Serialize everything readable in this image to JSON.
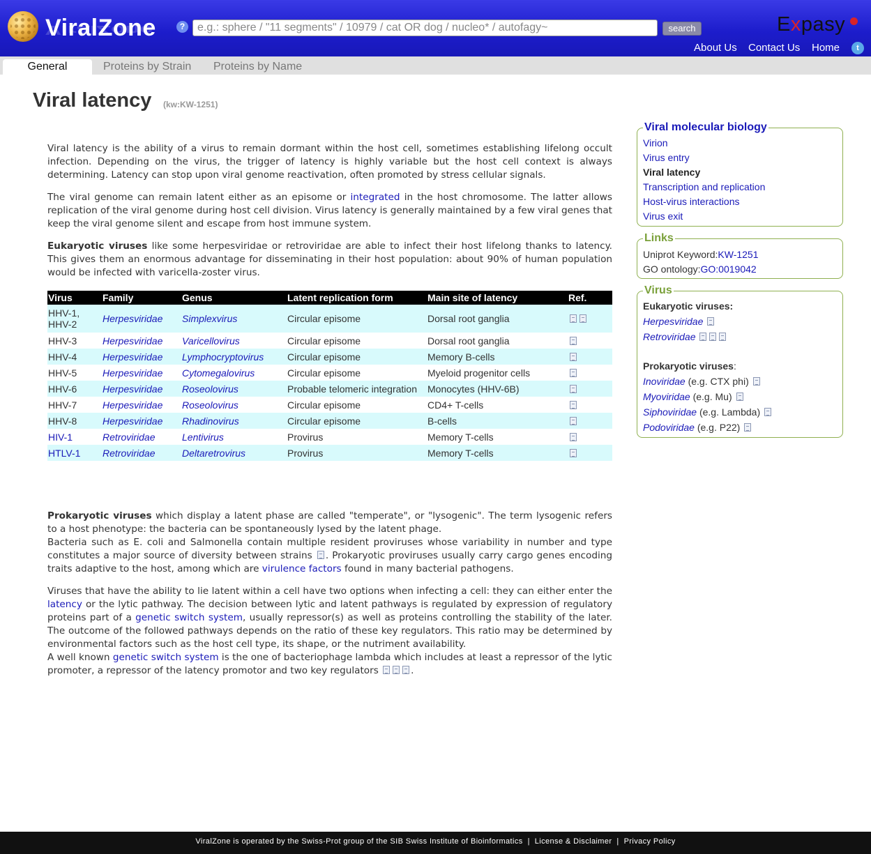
{
  "header": {
    "logo_text": "ViralZone",
    "help_label": "?",
    "search_placeholder": "e.g.: sphere / \"11 segments\" / 10979 / cat OR dog / nucleo* / autofagy~",
    "search_button": "search",
    "expasy_pre": "E",
    "expasy_x": "x",
    "expasy_post": "pasy",
    "nav": [
      "About Us",
      "Contact Us",
      "Home"
    ],
    "twitter_icon": "twitter-icon"
  },
  "tabs": [
    "General",
    "Proteins by Strain",
    "Proteins by Name"
  ],
  "title": "Viral latency",
  "keyword": "(kw:KW-1251)",
  "intro": {
    "p1": "Viral latency is the ability of a virus to remain dormant within the host cell, sometimes establishing lifelong occult infection. Depending on the virus, the trigger of latency is highly variable but the host cell context is always determining. Latency can stop upon viral genome reactivation, often promoted by stress cellular signals.",
    "p2_a": "The viral genome can remain latent either as an episome or ",
    "p2_link": "integrated",
    "p2_b": " in the host chromosome. The latter allows replication of the viral genome during host cell division. Virus latency is generally maintained by a few viral genes that keep the viral genome silent and escape from host immune system.",
    "p3_bold": "Eukaryotic viruses",
    "p3_rest": " like some herpesviridae or retroviridae are able to infect their host lifelong thanks to latency. This gives them an enormous advantage for disseminating in their host population: about 90% of human population would be infected with varicella-zoster virus."
  },
  "table": {
    "headers": [
      "Virus",
      "Family",
      "Genus",
      "Latent replication form",
      "Main site of latency",
      "Ref."
    ],
    "rows": [
      {
        "virus": "HHV-1, HHV-2",
        "family": "Herpesviridae",
        "genus": "Simplexvirus",
        "form": "Circular episome",
        "site": "Dorsal root ganglia",
        "refs": 2
      },
      {
        "virus": "HHV-3",
        "family": "Herpesviridae",
        "genus": "Varicellovirus",
        "form": "Circular episome",
        "site": "Dorsal root ganglia",
        "refs": 1
      },
      {
        "virus": "HHV-4",
        "family": "Herpesviridae",
        "genus": "Lymphocryptovirus",
        "form": "Circular episome",
        "site": "Memory B-cells",
        "refs": 1
      },
      {
        "virus": "HHV-5",
        "family": "Herpesviridae",
        "genus": "Cytomegalovirus",
        "form": "Circular episome",
        "site": "Myeloid progenitor cells",
        "refs": 1
      },
      {
        "virus": "HHV-6",
        "family": "Herpesviridae",
        "genus": "Roseolovirus",
        "form": "Probable telomeric integration",
        "site": "Monocytes (HHV-6B)",
        "refs": 1
      },
      {
        "virus": "HHV-7",
        "family": "Herpesviridae",
        "genus": "Roseolovirus",
        "form": "Circular episome",
        "site": "CD4+ T-cells",
        "refs": 1
      },
      {
        "virus": "HHV-8",
        "family": "Herpesviridae",
        "genus": "Rhadinovirus",
        "form": "Circular episome",
        "site": "B-cells",
        "refs": 1
      },
      {
        "virus": "HIV-1",
        "family": "Retroviridae",
        "genus": "Lentivirus",
        "form": "Provirus",
        "site": "Memory T-cells",
        "refs": 1,
        "virus_link": true
      },
      {
        "virus": "HTLV-1",
        "family": "Retroviridae",
        "genus": "Deltaretrovirus",
        "form": "Provirus",
        "site": "Memory T-cells",
        "refs": 1,
        "virus_link": true
      }
    ]
  },
  "prokaryotic": {
    "p1_bold": "Prokaryotic viruses",
    "p1_rest": " which display a latent phase are called \"temperate\", or \"lysogenic\". The term lysogenic refers to a host phenotype: the bacteria can be spontaneously lysed by the latent phage.",
    "p1_b": "Bacteria such as E. coli and Salmonella contain multiple resident proviruses whose variability in number and type constitutes a major source of diversity between strains ",
    "p1_c": ". Prokaryotic proviruses usually carry cargo genes encoding traits adaptive to the host, among which are ",
    "p1_link": "virulence factors",
    "p1_d": " found in many bacterial pathogens.",
    "p2_a": "Viruses that have the ability to lie latent within a cell have two options when infecting a cell: they can either enter the ",
    "p2_link1": "latency",
    "p2_b": " or the lytic pathway. The decision between lytic and latent pathways is regulated by expression of regulatory proteins part of a ",
    "p2_link2": "genetic switch system",
    "p2_c": ", usually repressor(s) as well as proteins controlling the stability of the later. The outcome of the followed pathways depends on the ratio of these key regulators. This ratio may be determined by environmental factors such as the host cell type, its shape, or the nutriment availability.",
    "p3_a": "A well known ",
    "p3_link": "genetic switch system",
    "p3_b": " is the one of bacteriophage lambda which includes at least a repressor of the lytic promoter, a repressor of the latency promotor and two key regulators ",
    "p3_end": "."
  },
  "sidebar": {
    "molbio": {
      "title": "Viral molecular biology",
      "items": [
        "Virion",
        "Virus entry",
        "Viral latency",
        "Transcription and replication",
        "Host-virus interactions",
        "Virus exit"
      ]
    },
    "links": {
      "title": "Links",
      "uniprot_label": "Uniprot Keyword:",
      "uniprot_value": "KW-1251",
      "go_label": "GO ontology:",
      "go_value": "GO:0019042"
    },
    "virus": {
      "title": "Virus",
      "euk_heading": "Eukaryotic viruses:",
      "euk": [
        {
          "name": "Herpesviridae",
          "refs": 1
        },
        {
          "name": "Retroviridae",
          "refs": 3
        }
      ],
      "prok_heading": "Prokaryotic viruses",
      "prok_colon": ":",
      "prok": [
        {
          "name": "Inoviridae",
          "note": " (e.g. CTX phi)"
        },
        {
          "name": "Myoviridae",
          "note": " (e.g. Mu)"
        },
        {
          "name": "Siphoviridae",
          "note": " (e.g. Lambda)"
        },
        {
          "name": "Podoviridae",
          "note": " (e.g. P22)"
        }
      ]
    }
  },
  "footer": {
    "text": "ViralZone is operated by the Swiss-Prot group of the SIB Swiss Institute of Bioinformatics",
    "sep": "|",
    "license": "License & Disclaimer",
    "privacy": "Privacy Policy"
  },
  "colors": {
    "header_blue": "#1d1dcc",
    "link": "#1a1ab8",
    "sidebar_border": "#8fb050",
    "table_alt": "#d8fafc"
  }
}
